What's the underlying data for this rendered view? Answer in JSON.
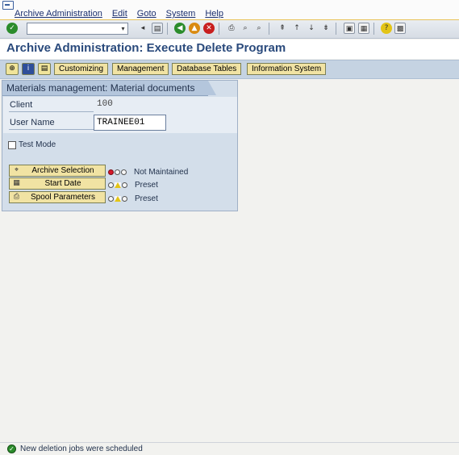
{
  "menu": {
    "items": [
      {
        "label": "Archive Administration"
      },
      {
        "label": "Edit"
      },
      {
        "label": "Goto"
      },
      {
        "label": "System"
      },
      {
        "label": "Help"
      }
    ]
  },
  "toolbar": {
    "command_field_value": ""
  },
  "title": "Archive Administration: Execute Delete Program",
  "app_toolbar": {
    "buttons": [
      "Customizing",
      "Management",
      "Database Tables",
      "Information System"
    ]
  },
  "panel": {
    "title": "Materials management: Material documents",
    "client_label": "Client",
    "client_value": "100",
    "user_label": "User Name",
    "user_value": "TRAINEE01",
    "test_mode_label": "Test Mode",
    "test_mode_checked": false,
    "rows": [
      {
        "button": "Archive Selection",
        "status": "Not Maintained",
        "light": "red"
      },
      {
        "button": "Start Date",
        "status": "Preset",
        "light": "yellow"
      },
      {
        "button": "Spool Parameters",
        "status": "Preset",
        "light": "yellow"
      }
    ]
  },
  "status_bar": {
    "message": "New deletion jobs were scheduled"
  },
  "colors": {
    "title": "#2a4a7c",
    "menu_text": "#1b2f6e",
    "button_bg": "#f1e3a3",
    "panel_bg": "#d3deea",
    "light_red": "#d6182a",
    "light_yellow": "#e3c416",
    "ok_green": "#2b8c2b"
  }
}
